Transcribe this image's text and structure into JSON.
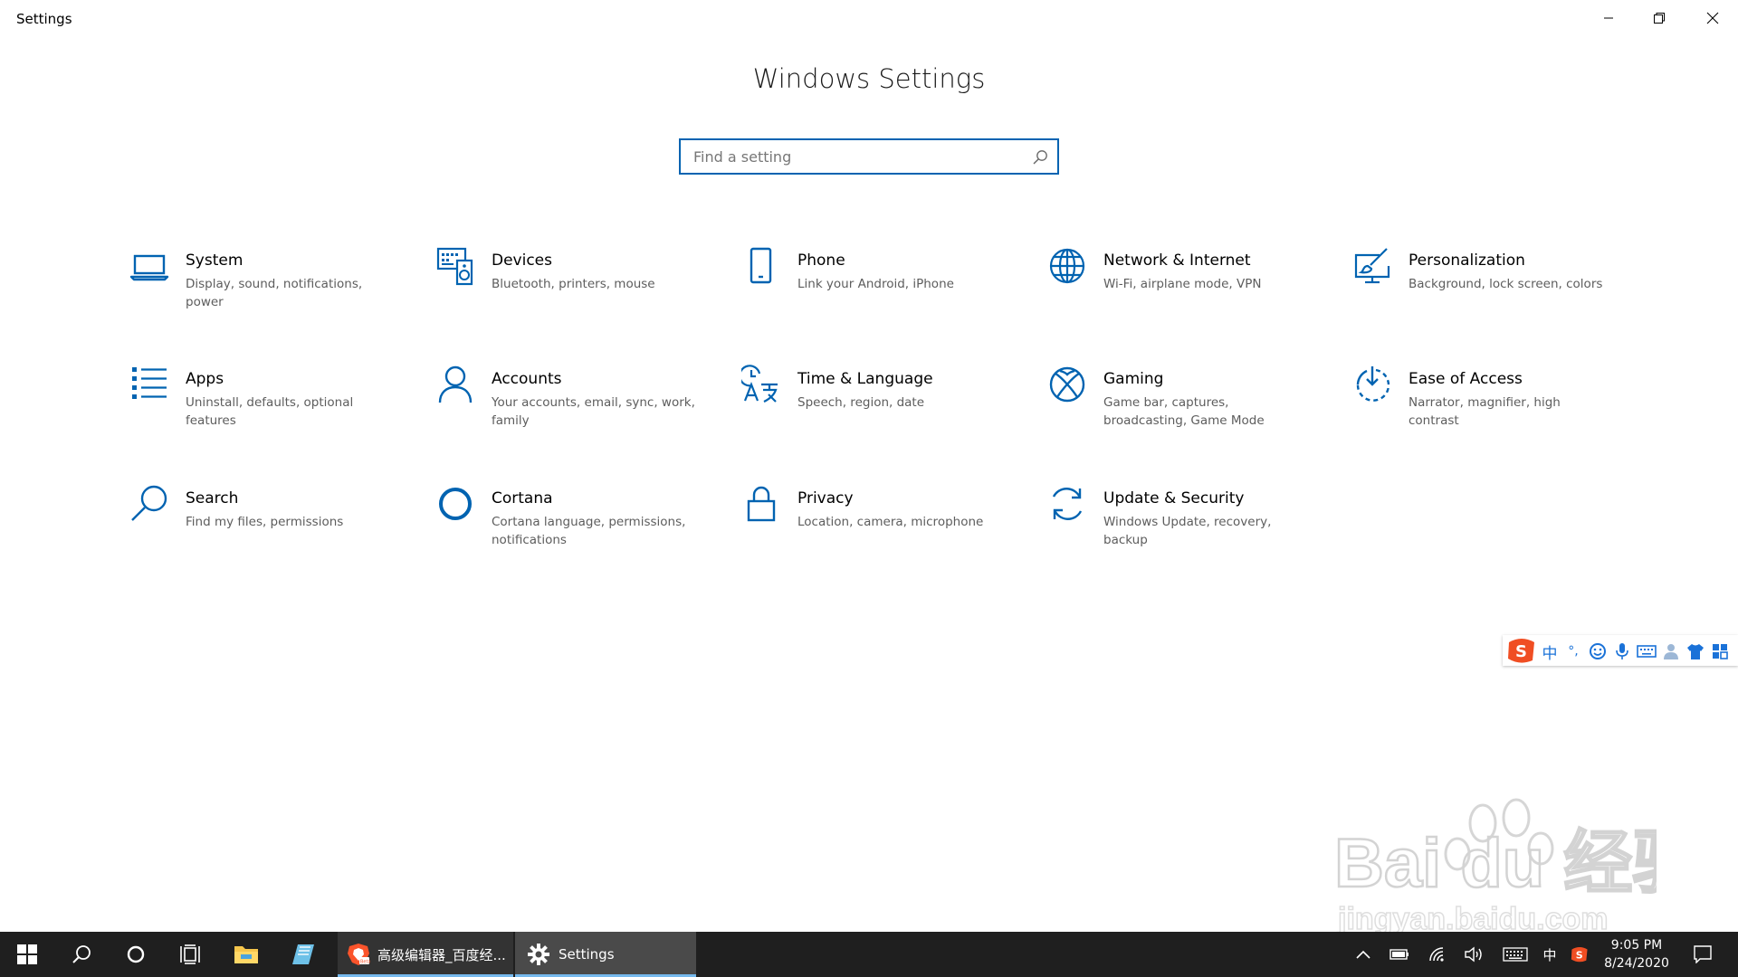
{
  "window": {
    "title": "Settings",
    "minimize_label": "Minimize",
    "maximize_label": "Restore",
    "close_label": "Close"
  },
  "page_title": "Windows Settings",
  "search": {
    "placeholder": "Find a setting",
    "icon": "search-icon"
  },
  "accent_color": "#0063b1",
  "categories": [
    {
      "title": "System",
      "desc": "Display, sound, notifications, power",
      "icon": "laptop-icon"
    },
    {
      "title": "Devices",
      "desc": "Bluetooth, printers, mouse",
      "icon": "keyboard-speaker-icon"
    },
    {
      "title": "Phone",
      "desc": "Link your Android, iPhone",
      "icon": "phone-icon"
    },
    {
      "title": "Network & Internet",
      "desc": "Wi-Fi, airplane mode, VPN",
      "icon": "globe-icon"
    },
    {
      "title": "Personalization",
      "desc": "Background, lock screen, colors",
      "icon": "paintbrush-icon"
    },
    {
      "title": "Apps",
      "desc": "Uninstall, defaults, optional features",
      "icon": "list-icon"
    },
    {
      "title": "Accounts",
      "desc": "Your accounts, email, sync, work, family",
      "icon": "person-icon"
    },
    {
      "title": "Time & Language",
      "desc": "Speech, region, date",
      "icon": "time-language-icon"
    },
    {
      "title": "Gaming",
      "desc": "Game bar, captures, broadcasting, Game Mode",
      "icon": "xbox-icon"
    },
    {
      "title": "Ease of Access",
      "desc": "Narrator, magnifier, high contrast",
      "icon": "ease-of-access-icon"
    },
    {
      "title": "Search",
      "desc": "Find my files, permissions",
      "icon": "search-icon"
    },
    {
      "title": "Cortana",
      "desc": "Cortana language, permissions, notifications",
      "icon": "cortana-icon"
    },
    {
      "title": "Privacy",
      "desc": "Location, camera, microphone",
      "icon": "lock-icon"
    },
    {
      "title": "Update & Security",
      "desc": "Windows Update, recovery, backup",
      "icon": "sync-icon"
    }
  ],
  "ime_toolbar": {
    "logo": "sogou-s-icon",
    "mode_label": "中",
    "punct_label": "°,",
    "icons": [
      "emoji-icon",
      "microphone-icon",
      "keyboard-icon",
      "user-icon",
      "shirt-icon",
      "grid-icon"
    ]
  },
  "watermark": {
    "line1": "Bai du 经验",
    "line2": "jingyan.baidu.com"
  },
  "taskbar": {
    "apps": [
      {
        "label": "高级编辑器_百度经...",
        "icon": "brave-browser-icon",
        "state": "open"
      },
      {
        "label": "Settings",
        "icon": "gear-icon",
        "state": "active"
      }
    ],
    "pinned": [
      "windows-start-icon",
      "search-icon",
      "cortana-circle-icon",
      "task-view-icon",
      "file-explorer-icon",
      "notepad-icon"
    ],
    "tray": {
      "ime_label": "中",
      "time": "9:05 PM",
      "date": "8/24/2020"
    }
  }
}
